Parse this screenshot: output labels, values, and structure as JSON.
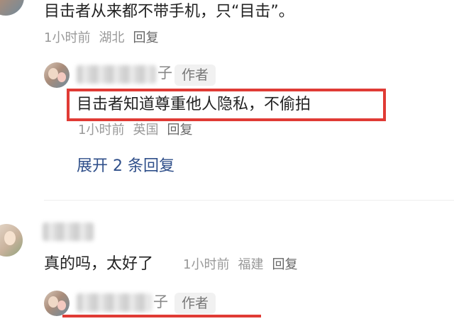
{
  "comment1": {
    "text": "目击者从来都不带手机，只“目击”。",
    "time": "1小时前",
    "location": "湖北",
    "reply_label": "回复"
  },
  "reply1": {
    "name_visible_suffix": "子",
    "author_badge": "作者",
    "text": "目击者知道尊重他人隐私，不偷拍",
    "time": "1小时前",
    "location": "英国",
    "reply_label": "回复",
    "highlight_color": "#e03b35"
  },
  "expand_replies": "展开 2 条回复",
  "comment2": {
    "text": "真的吗，太好了",
    "time": "1小时前",
    "location": "福建",
    "reply_label": "回复"
  },
  "reply2": {
    "name_visible_suffix": "子",
    "author_badge": "作者",
    "underline_color": "#e03b35"
  }
}
